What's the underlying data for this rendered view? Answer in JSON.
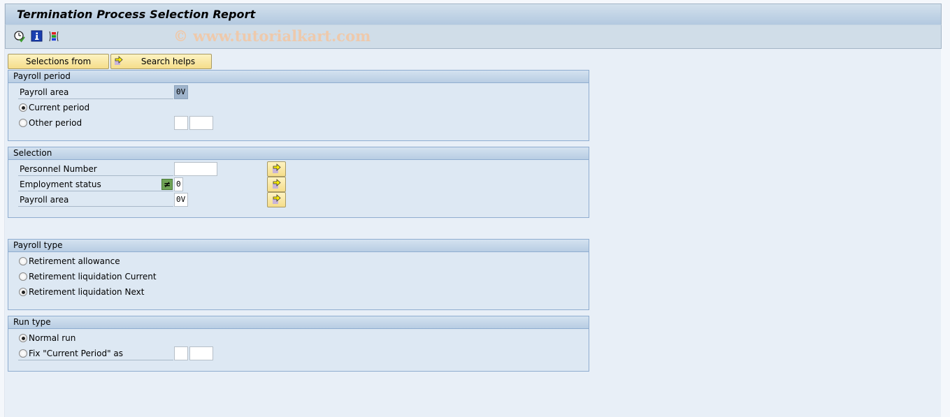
{
  "window": {
    "title": "Termination Process Selection Report",
    "watermark": "© www.tutorialkart.com"
  },
  "toolbar": {
    "icons": [
      "execute-clock-icon",
      "info-icon",
      "selection-options-icon"
    ]
  },
  "buttons": {
    "selections_from": "Selections from",
    "search_helps": "Search helps"
  },
  "payroll_period": {
    "title": "Payroll period",
    "payroll_area_label": "Payroll area",
    "payroll_area_value": "0V",
    "current_period_label": "Current period",
    "current_period_selected": true,
    "other_period_label": "Other period",
    "other_period_selected": false,
    "other_period_value1": "",
    "other_period_value2": ""
  },
  "selection": {
    "title": "Selection",
    "personnel_number_label": "Personnel Number",
    "personnel_number_value": "",
    "employment_status_label": "Employment status",
    "employment_status_operator": "≠",
    "employment_status_value": "0",
    "payroll_area_label": "Payroll area",
    "payroll_area_value": "0V"
  },
  "payroll_type": {
    "title": "Payroll type",
    "options": [
      {
        "label": "Retirement allowance",
        "selected": false
      },
      {
        "label": "Retirement liquidation Current",
        "selected": false
      },
      {
        "label": "Retirement liquidation Next",
        "selected": true
      }
    ]
  },
  "run_type": {
    "title": "Run type",
    "normal_run_label": "Normal run",
    "normal_run_selected": true,
    "fix_current_label": "Fix \"Current Period\" as",
    "fix_current_selected": false,
    "fix_value1": "",
    "fix_value2": ""
  }
}
